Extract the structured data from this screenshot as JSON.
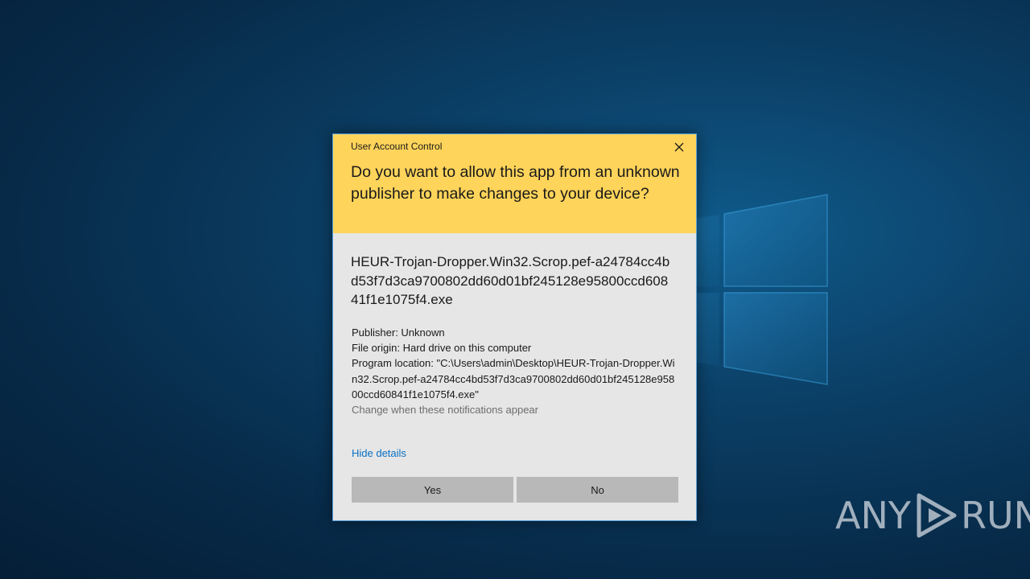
{
  "dialog": {
    "title": "User Account Control",
    "question": "Do you want to allow this app from an unknown publisher to make changes to your device?",
    "app_name": "HEUR-Trojan-Dropper.Win32.Scrop.pef-a24784cc4bd53f7d3ca9700802dd60d01bf245128e95800ccd60841f1e1075f4.exe",
    "publisher": "Publisher: Unknown",
    "file_origin": "File origin: Hard drive on this computer",
    "program_location": "Program location: \"C:\\Users\\admin\\Desktop\\HEUR-Trojan-Dropper.Win32.Scrop.pef-a24784cc4bd53f7d3ca9700802dd60d01bf245128e95800ccd60841f1e1075f4.exe\"",
    "change_notifications_link": "Change when these notifications appear",
    "hide_details_link": "Hide details",
    "yes_label": "Yes",
    "no_label": "No",
    "header_color": "#ffd45a",
    "body_color": "#e6e6e6",
    "link_color": "#0a6fc2",
    "close_icon": "close-icon"
  },
  "watermark": {
    "text_left": "ANY",
    "text_right": "RUN",
    "icon": "play-icon"
  }
}
